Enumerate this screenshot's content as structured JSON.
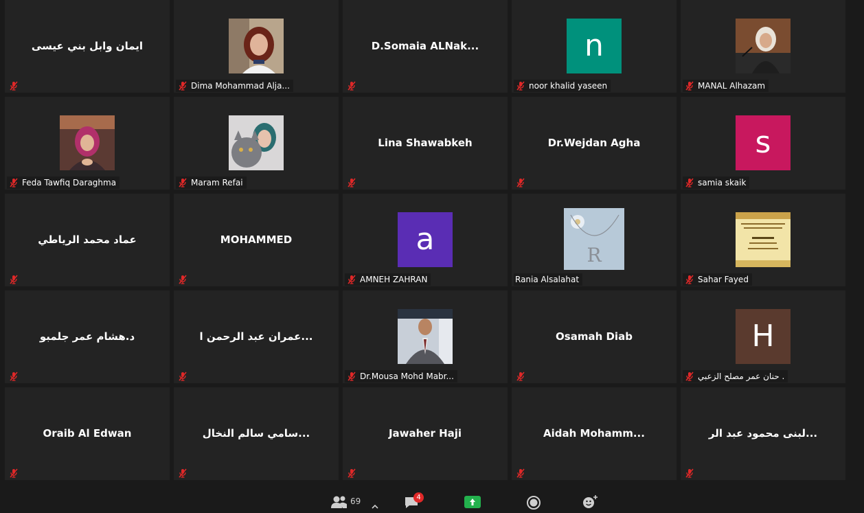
{
  "tiles": [
    {
      "display": "name",
      "name": "ايمان وابل بني عيسى",
      "label": ""
    },
    {
      "display": "photo",
      "photo": "woman-red-hair-photo",
      "label": "Dima  Mohammad Alja..."
    },
    {
      "display": "name",
      "name": "D.Somaia  ALNak...",
      "label": ""
    },
    {
      "display": "letter",
      "letter": "n",
      "color": "#00917c",
      "label": "noor khalid yaseen"
    },
    {
      "display": "photo",
      "photo": "woman-hijab-microphone-photo",
      "label": "MANAL Alhazam"
    },
    {
      "display": "photo",
      "photo": "woman-pink-hijab-photo",
      "label": "Feda Tawfiq Daraghma"
    },
    {
      "display": "photo",
      "photo": "woman-with-cat-photo",
      "label": "Maram Refai"
    },
    {
      "display": "name",
      "name": "Lina Shawabkeh",
      "label": ""
    },
    {
      "display": "name",
      "name": "Dr.Wejdan Agha",
      "label": ""
    },
    {
      "display": "letter",
      "letter": "s",
      "color": "#c8185e",
      "label": "samia skaik"
    },
    {
      "display": "name",
      "name": "عماد محمد الرياطي",
      "label": ""
    },
    {
      "display": "name",
      "name": "MOHAMMED",
      "label": ""
    },
    {
      "display": "letter",
      "letter": "a",
      "color": "#5a2db4",
      "label": "AMNEH ZAHRAN"
    },
    {
      "display": "photo",
      "photo": "necklace-letter-r-photo",
      "label": "Rania Alsalahat"
    },
    {
      "display": "photo",
      "photo": "yellow-document-photo",
      "label": "Sahar Fayed"
    },
    {
      "display": "name",
      "name": "د.هشام عمر جلمبو",
      "label": ""
    },
    {
      "display": "name",
      "name": "عمران عبد الرحمن ا...",
      "label": ""
    },
    {
      "display": "photo",
      "photo": "man-suit-photo",
      "label": "Dr.Mousa Mohd Mabr..."
    },
    {
      "display": "name",
      "name": "Osamah Diab",
      "label": ""
    },
    {
      "display": "letter",
      "letter": "H",
      "color": "#5a3a2e",
      "label": "حنان عمر مصلح الزعبي ."
    },
    {
      "display": "name",
      "name": "Oraib Al Edwan",
      "label": ""
    },
    {
      "display": "name",
      "name": "سامي سالم النخال...",
      "label": ""
    },
    {
      "display": "name",
      "name": "Jawaher Haji",
      "label": ""
    },
    {
      "display": "name",
      "name": "Aidah  Mohamm...",
      "label": ""
    },
    {
      "display": "name",
      "name": "لبنى محمود عبد الر...",
      "label": ""
    }
  ],
  "toolbar": {
    "participants_count": "69",
    "chat_badge": "4",
    "icons": [
      "participants-icon",
      "chevron-up-icon",
      "chat-icon",
      "share-screen-icon",
      "record-icon",
      "reactions-icon"
    ]
  },
  "colors": {
    "tile_bg": "#232323",
    "muted_icon": "#e02828",
    "share_green": "#23b14d"
  }
}
